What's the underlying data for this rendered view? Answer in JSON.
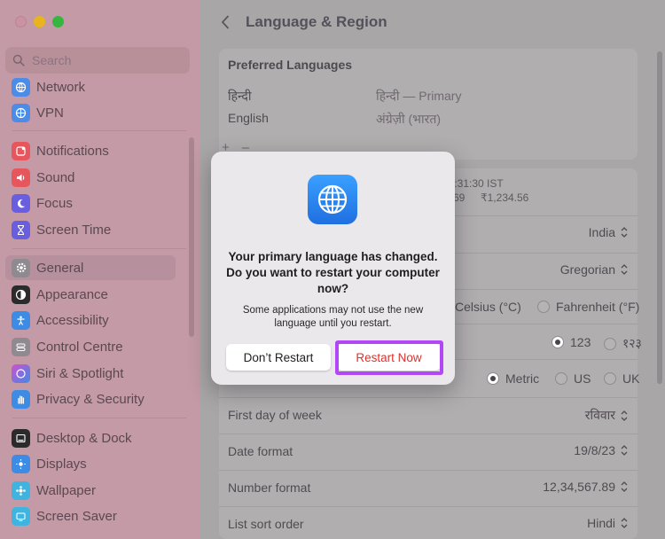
{
  "sidebar": {
    "search_placeholder": "Search",
    "items": [
      {
        "label": "Network",
        "icon": "network-icon",
        "color": "#4c8ce8"
      },
      {
        "label": "VPN",
        "icon": "vpn-icon",
        "color": "#4c8ce8"
      },
      {
        "label": "Notifications",
        "icon": "bell-icon",
        "color": "#e8565d"
      },
      {
        "label": "Sound",
        "icon": "speaker-icon",
        "color": "#e8565d"
      },
      {
        "label": "Focus",
        "icon": "moon-icon",
        "color": "#6a5ee0"
      },
      {
        "label": "Screen Time",
        "icon": "hourglass-icon",
        "color": "#6a5ee0"
      },
      {
        "label": "General",
        "icon": "gear-icon",
        "color": "#8f8a8f"
      },
      {
        "label": "Appearance",
        "icon": "appearance-icon",
        "color": "#2b2b2b"
      },
      {
        "label": "Accessibility",
        "icon": "accessibility-icon",
        "color": "#3c8ce6"
      },
      {
        "label": "Control Centre",
        "icon": "control-centre-icon",
        "color": "#8f8a8f"
      },
      {
        "label": "Siri & Spotlight",
        "icon": "siri-icon",
        "color": "#b04fd1"
      },
      {
        "label": "Privacy & Security",
        "icon": "hand-icon",
        "color": "#3c8ce6"
      },
      {
        "label": "Desktop & Dock",
        "icon": "dock-icon",
        "color": "#2b2b2b"
      },
      {
        "label": "Displays",
        "icon": "displays-icon",
        "color": "#3c8ce6"
      },
      {
        "label": "Wallpaper",
        "icon": "wallpaper-icon",
        "color": "#3fb4e0"
      },
      {
        "label": "Screen Saver",
        "icon": "screen-saver-icon",
        "color": "#3fb4e0"
      }
    ]
  },
  "main": {
    "title": "Language & Region",
    "preferred_languages_title": "Preferred Languages",
    "languages": [
      {
        "name": "हिन्दी",
        "detail": "हिन्दी — Primary"
      },
      {
        "name": "English",
        "detail": "अंग्रेज़ी (भारत)"
      }
    ],
    "add_button": "+",
    "remove_button": "–",
    "preview_time": "20:31:30 IST",
    "preview_num_left": "69",
    "preview_num_right": "₹1,234.56",
    "region_value": "India",
    "calendar_value": "Gregorian",
    "temp_celsius": "Celsius (°C)",
    "temp_fahrenheit": "Fahrenheit (°F)",
    "numbers_123": "123",
    "numbers_hindi": "१२३",
    "measure_metric": "Metric",
    "measure_us": "US",
    "measure_uk": "UK",
    "first_day_label": "First day of week",
    "first_day_value": "रविवार",
    "date_format_label": "Date format",
    "date_format_value": "19/8/23",
    "number_format_label": "Number format",
    "number_format_value": "12,34,567.89",
    "list_sort_label": "List sort order",
    "list_sort_value": "Hindi"
  },
  "dialog": {
    "title": "Your primary language has changed. Do you want to restart your computer now?",
    "message": "Some applications may not use the new language until you restart.",
    "dont_restart": "Don’t Restart",
    "restart_now": "Restart Now",
    "highlight_color": "#b247f5"
  }
}
